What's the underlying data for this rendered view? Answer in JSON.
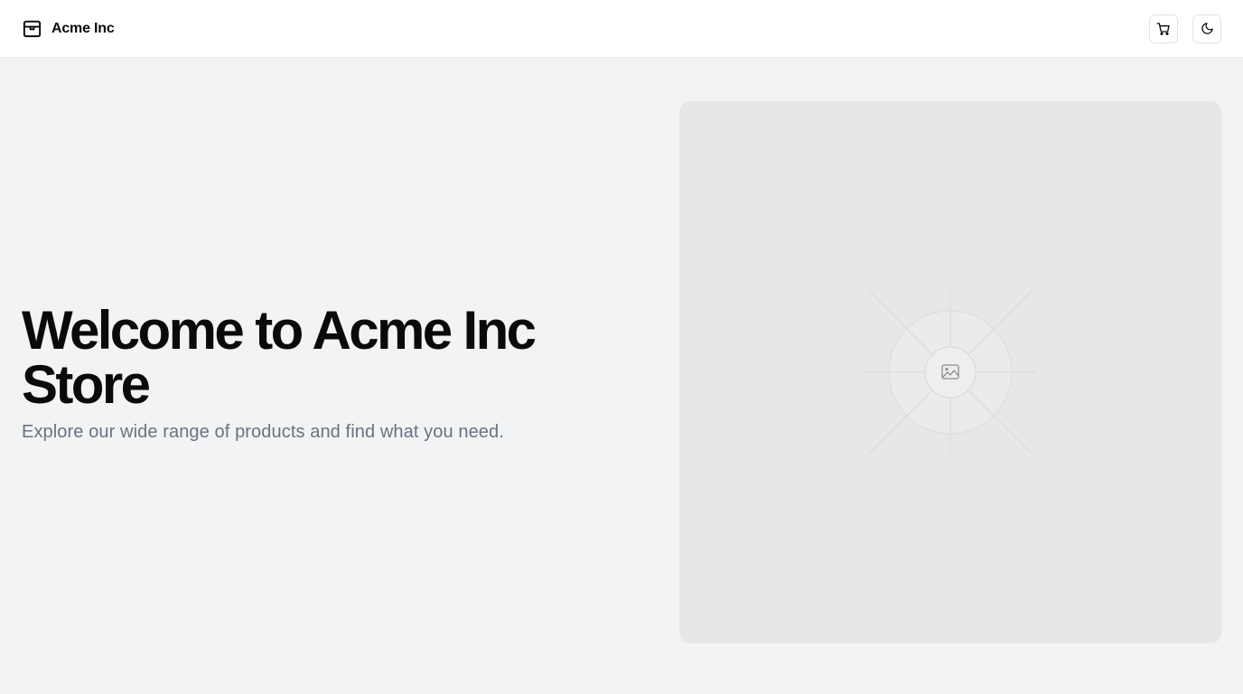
{
  "header": {
    "brand_name": "Acme Inc",
    "brand_icon": "package-icon",
    "actions": [
      {
        "name": "cart-button",
        "icon": "shopping-cart-icon"
      },
      {
        "name": "theme-toggle-button",
        "icon": "moon-icon"
      }
    ]
  },
  "hero": {
    "title": "Welcome to Acme Inc Store",
    "subtitle": "Explore our wide range of products and find what you need."
  },
  "image_panel": {
    "icon": "image-placeholder-icon"
  },
  "colors": {
    "page_background": "#f1f3f5",
    "header_background": "#ffffff",
    "text_primary": "#0a0a0a",
    "text_muted": "#6b7280",
    "panel_background": "#e7e7e8"
  }
}
